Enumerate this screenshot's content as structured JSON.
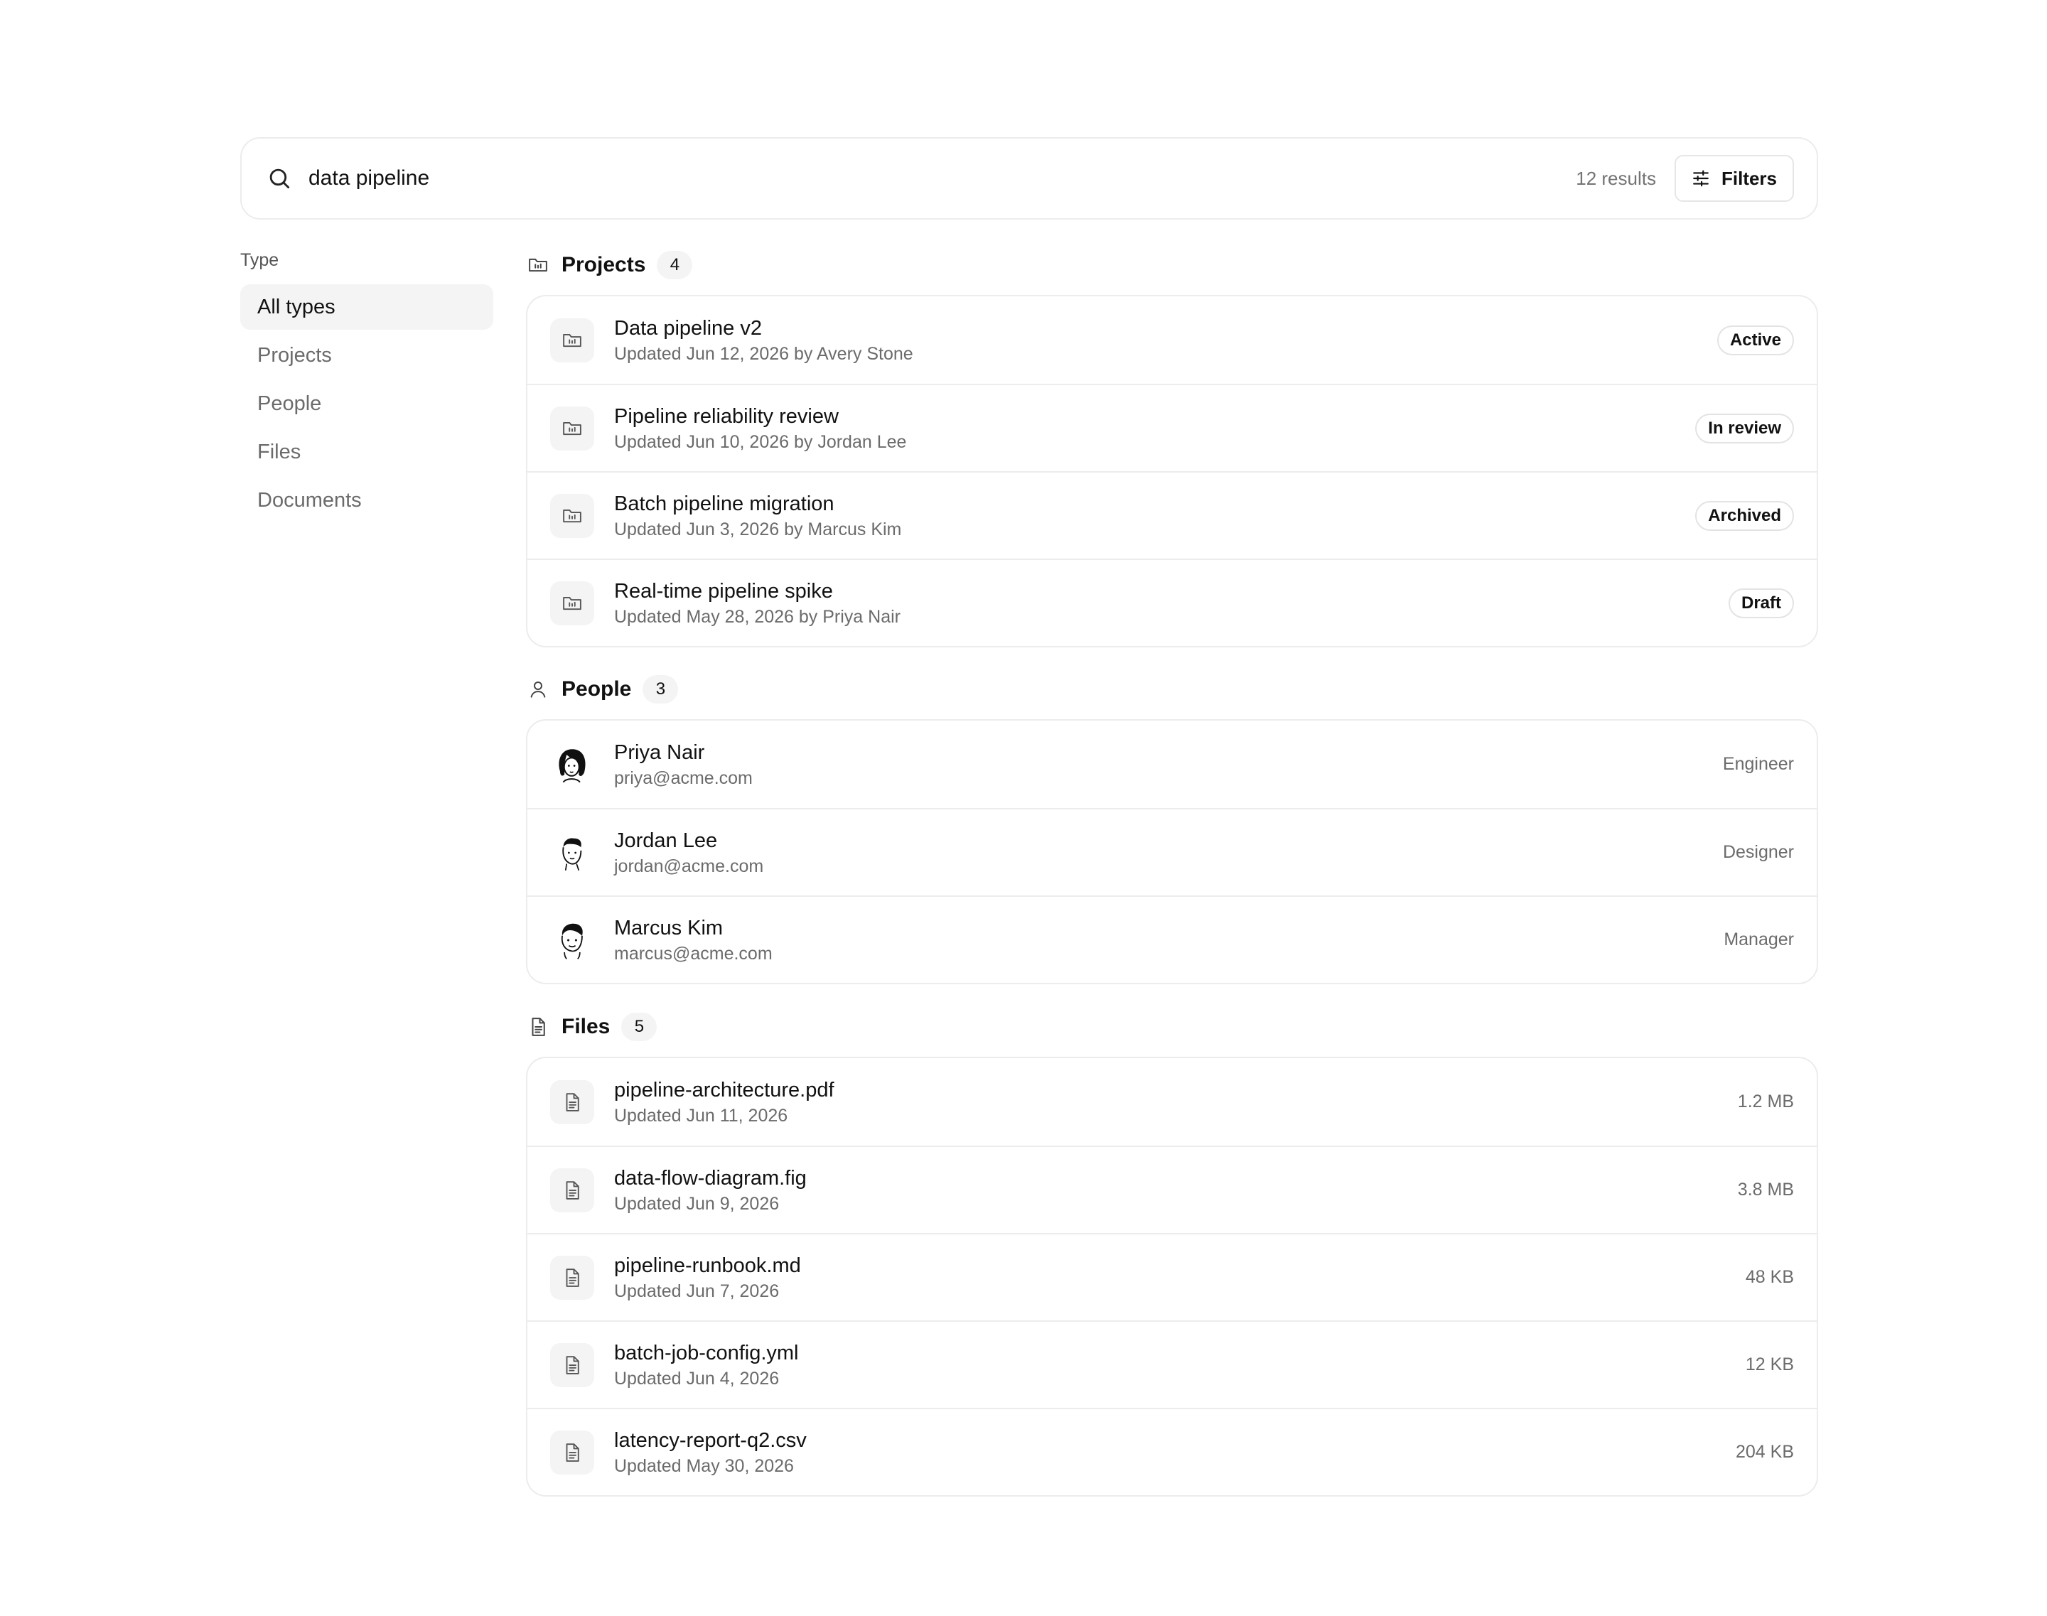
{
  "search": {
    "query": "data pipeline",
    "result_count": "12 results",
    "filters_label": "Filters"
  },
  "sidebar": {
    "heading": "Type",
    "items": [
      {
        "label": "All types",
        "active": true
      },
      {
        "label": "Projects"
      },
      {
        "label": "People"
      },
      {
        "label": "Files"
      },
      {
        "label": "Documents"
      }
    ]
  },
  "projects": {
    "title": "Projects",
    "count": "4",
    "icon": "folder-icon",
    "items": [
      {
        "title": "Data pipeline v2",
        "subtitle": "Updated Jun 12, 2026 by Avery Stone",
        "status": "Active"
      },
      {
        "title": "Pipeline reliability review",
        "subtitle": "Updated Jun 10, 2026 by Jordan Lee",
        "status": "In review"
      },
      {
        "title": "Batch pipeline migration",
        "subtitle": "Updated Jun 3, 2026 by Marcus Kim",
        "status": "Archived"
      },
      {
        "title": "Real-time pipeline spike",
        "subtitle": "Updated May 28, 2026 by Priya Nair",
        "status": "Draft"
      }
    ]
  },
  "people": {
    "title": "People",
    "count": "3",
    "icon": "user-icon",
    "items": [
      {
        "name": "Priya Nair",
        "email": "priya@acme.com",
        "role": "Engineer",
        "avatar": "avatar-priya"
      },
      {
        "name": "Jordan Lee",
        "email": "jordan@acme.com",
        "role": "Designer",
        "avatar": "avatar-jordan"
      },
      {
        "name": "Marcus Kim",
        "email": "marcus@acme.com",
        "role": "Manager",
        "avatar": "avatar-marcus"
      }
    ]
  },
  "files": {
    "title": "Files",
    "count": "5",
    "icon": "file-icon",
    "items": [
      {
        "name": "pipeline-architecture.pdf",
        "updated": "Updated Jun 11, 2026",
        "size": "1.2 MB"
      },
      {
        "name": "data-flow-diagram.fig",
        "updated": "Updated Jun 9, 2026",
        "size": "3.8 MB"
      },
      {
        "name": "pipeline-runbook.md",
        "updated": "Updated Jun 7, 2026",
        "size": "48 KB"
      },
      {
        "name": "batch-job-config.yml",
        "updated": "Updated Jun 4, 2026",
        "size": "12 KB"
      },
      {
        "name": "latency-report-q2.csv",
        "updated": "Updated May 30, 2026",
        "size": "204 KB"
      }
    ]
  },
  "colors": {
    "text": "#111111",
    "muted": "#6b6b6b",
    "border": "#ececec",
    "chip_bg": "#f4f4f4"
  }
}
